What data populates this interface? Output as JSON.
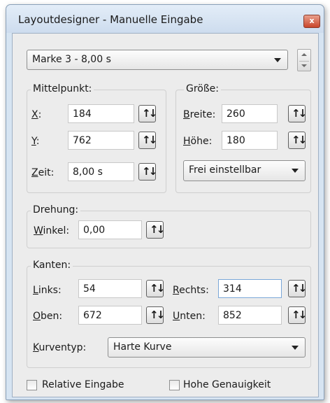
{
  "window": {
    "title": "Layoutdesigner - Manuelle Eingabe",
    "close": "x"
  },
  "marker": {
    "selected": "Marke 3 - 8,00 s"
  },
  "mittelpunkt": {
    "title": "Mittelpunkt:",
    "x": {
      "label_u": "X",
      "label_rest": ":",
      "value": "184"
    },
    "y": {
      "label_u": "Y",
      "label_rest": ":",
      "value": "762"
    },
    "zeit": {
      "label_u": "Z",
      "label_rest": "eit:",
      "value": "8,00 s"
    }
  },
  "groesse": {
    "title": "Größe:",
    "breite": {
      "label_u": "B",
      "label_rest": "reite:",
      "value": "260"
    },
    "hoehe": {
      "label_u": "H",
      "label_rest": "öhe:",
      "value": "180"
    },
    "mode": "Frei einstellbar"
  },
  "drehung": {
    "title": "Drehung:",
    "winkel": {
      "label_u": "W",
      "label_rest": "inkel:",
      "value": "0,00"
    }
  },
  "kanten": {
    "title": "Kanten:",
    "links": {
      "label_u": "L",
      "label_rest": "inks:",
      "value": "54"
    },
    "rechts": {
      "label_u": "R",
      "label_rest": "echts:",
      "value": "314"
    },
    "oben": {
      "label_u": "O",
      "label_rest": "ben:",
      "value": "672"
    },
    "unten": {
      "label_u": "U",
      "label_rest": "nten:",
      "value": "852"
    },
    "kurventyp": {
      "label_u": "K",
      "label_rest": "urventyp:",
      "value": "Harte Kurve"
    }
  },
  "options": {
    "relative": {
      "label": "Relative Eingabe",
      "checked": false
    },
    "genauigkeit": {
      "label": "Hohe Genauigkeit",
      "checked": false
    }
  },
  "spin_glyph": "↑↓"
}
